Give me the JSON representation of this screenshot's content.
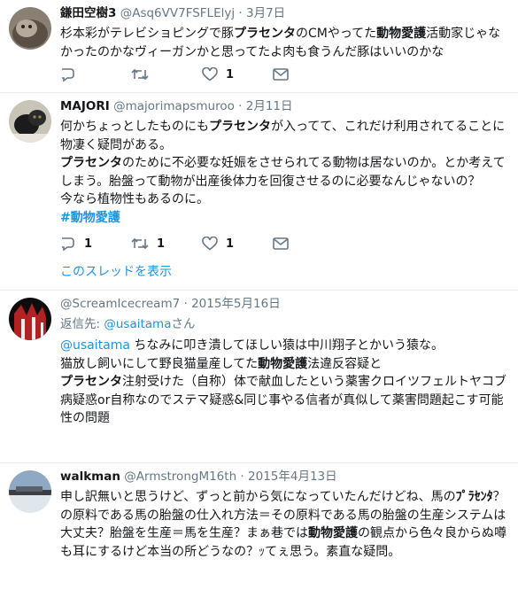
{
  "tweets": [
    {
      "name": "鎌田空樹3",
      "handle": "@Asq6VV7FSFLElyj",
      "time": "3月7日",
      "body": [
        "杉本彩がテレビショピングで豚",
        "プラセンタ",
        "のCMやってた",
        "動物愛護",
        "活動家じゃなかったのかなヴィーガンかと思ってたよ肉も食うんだ豚はいいのかな"
      ],
      "replies": "",
      "retweets": "",
      "likes": "1"
    },
    {
      "name": "MAJORI",
      "handle": "@majorimapsmuroo",
      "time": "2月11日",
      "body": {
        "p1a": "何かちょっとしたものにも",
        "p1b": "プラセンタ",
        "p1c": "が入ってて、これだけ利用されてることに物凄く疑問がある。",
        "p2a": "プラセンタ",
        "p2b": "のために不必要な妊娠をさせられてる動物は居ないのか。とか考えてしまう。胎盤って動物が出産後体力を回復させるのに必要なんじゃないの？",
        "p3": "今なら植物性もあるのに。",
        "hashtag": "#動物愛護"
      },
      "replies": "1",
      "retweets": "1",
      "likes": "1",
      "thread_link": "このスレッドを表示"
    },
    {
      "name": "",
      "handle": "@ScreamIcecream7",
      "time": "2015年5月16日",
      "reply_to_label": "返信先:",
      "reply_to_user": "@usaitama",
      "reply_to_suffix": "さん",
      "body": {
        "mention": "@usaitama",
        "l1": " ちなみに叩き潰してほしい猿は中川翔子とかいう猿な。",
        "l2a": "猫放し飼いにして野良猫量産してた",
        "l2b": "動物愛護",
        "l2c": "法違反容疑と",
        "l3a": "プラセンタ",
        "l3b": "注射受けた（自称）体で献血したという薬害クロイツフェルトヤコブ病疑惑or自称なのでステマ疑惑&同じ事やる信者が真似して薬害問題起こす可能性の問題"
      }
    },
    {
      "name": "walkman",
      "handle": "@ArmstrongM16th",
      "time": "2015年4月13日",
      "body": {
        "a": "申し訳無いと思うけど、ずっと前から気になっていたんだけどね、馬の",
        "b": "ﾌﾟﾗｾﾝﾀ",
        "c": "？の原料である馬の胎盤の仕入れ方法＝その原料である馬の胎盤の生産システムは大丈夫？胎盤を生産＝馬を生産？まぁ巷では",
        "d": "動物愛護",
        "e": "の観点から色々良からぬ噂も耳にするけど本当の所どうなの？ｯてぇ思う。素直な疑問。"
      }
    }
  ],
  "separator": "·",
  "colors": {
    "link": "#1b95e0",
    "muted": "#657786",
    "text": "#14171a",
    "divider": "#e6ecf0"
  }
}
